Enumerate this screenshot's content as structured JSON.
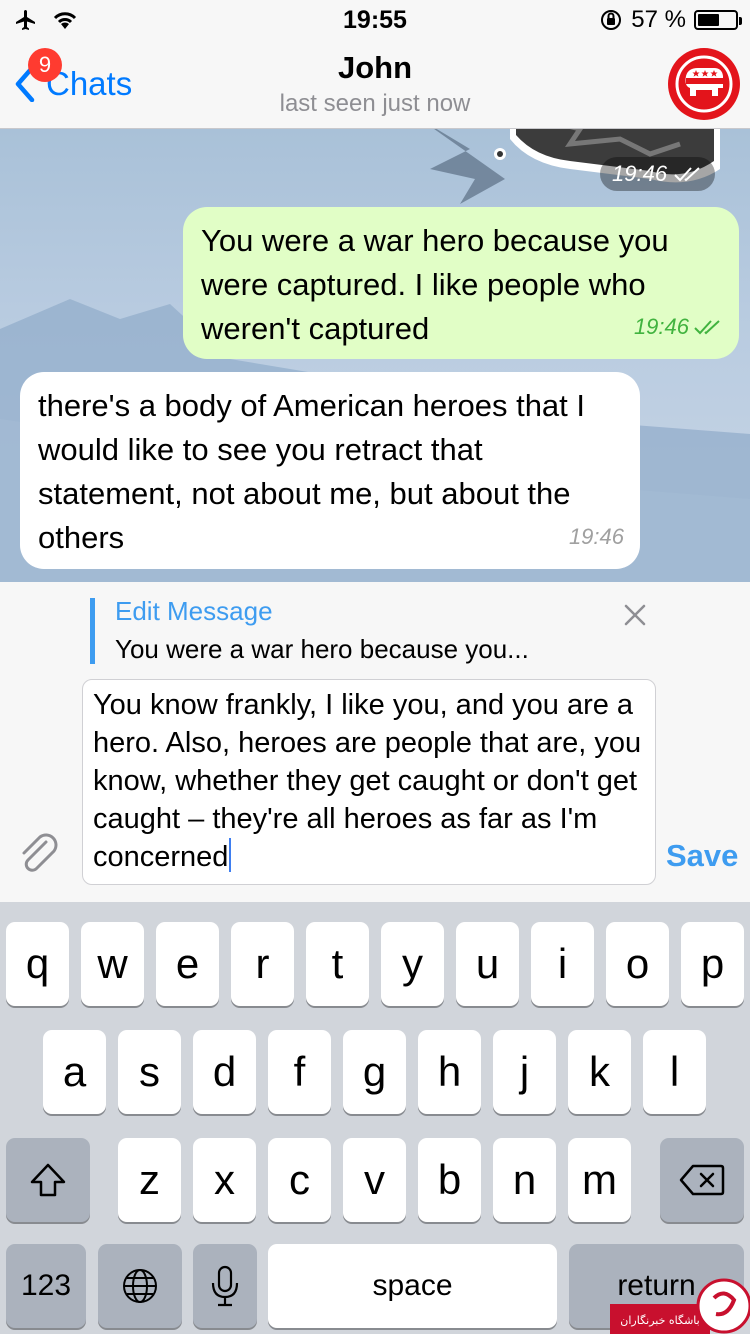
{
  "status_bar": {
    "time": "19:55",
    "battery_percent": "57 %",
    "battery_level": 0.57
  },
  "nav": {
    "back_label": "Chats",
    "badge_count": "9",
    "contact_name": "John",
    "last_seen": "last seen just now"
  },
  "messages": [
    {
      "direction": "out",
      "type": "sticker",
      "time": "19:46"
    },
    {
      "direction": "out",
      "text": "You were a war hero because you were captured. I like people who weren't captured",
      "time": "19:46"
    },
    {
      "direction": "in",
      "text": "there's a body of American heroes that I would like to see you retract that statement, not about me, but about the others",
      "time": "19:46"
    }
  ],
  "edit": {
    "title": "Edit Message",
    "preview": "You were a war hero because you...",
    "text": "You know frankly, I like you, and you are a hero. Also, heroes are people that are, you know, whether they get caught or don't get caught – they're all heroes as far as I'm concerned",
    "save_label": "Save"
  },
  "keyboard": {
    "row1": [
      "q",
      "w",
      "e",
      "r",
      "t",
      "y",
      "u",
      "i",
      "o",
      "p"
    ],
    "row2": [
      "a",
      "s",
      "d",
      "f",
      "g",
      "h",
      "j",
      "k",
      "l"
    ],
    "row3": [
      "z",
      "x",
      "c",
      "v",
      "b",
      "n",
      "m"
    ],
    "numbers_label": "123",
    "space_label": "space",
    "return_label": "return"
  },
  "watermark": {
    "text": "باشگاه خبرنگاران"
  },
  "colors": {
    "accent": "#007aff",
    "outgoing_bubble": "#e1fec6",
    "read_check": "#41b33f",
    "edit_accent": "#3e9cf0",
    "badge": "#ff3b30",
    "avatar": "#e3141b"
  },
  "icons": {
    "back": "chevron-left-icon",
    "attach": "paperclip-icon",
    "close": "close-icon",
    "shift": "shift-icon",
    "delete": "backspace-icon",
    "globe": "globe-icon",
    "mic": "microphone-icon",
    "avatar": "elephant-icon",
    "check": "double-check-icon"
  }
}
